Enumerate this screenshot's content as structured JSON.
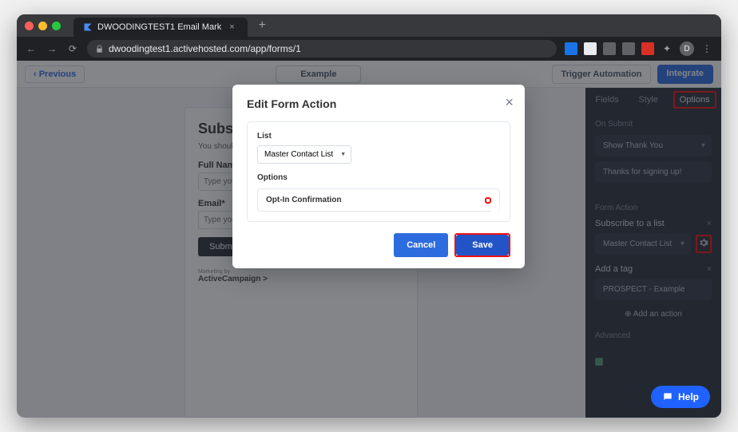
{
  "browser": {
    "tab_title": "DWOODINGTEST1 Email Mark",
    "url": "dwoodingtest1.activehosted.com/app/forms/1",
    "avatar_initial": "D"
  },
  "topbar": {
    "previous": "‹  Previous",
    "form_name": "Example",
    "trigger": "Trigger Automation",
    "integrate": "Integrate"
  },
  "form": {
    "title": "Subscr",
    "subtitle": "You should",
    "fullname_label": "Full Name",
    "fullname_placeholder": "Type your",
    "email_label": "Email*",
    "email_placeholder": "Type your",
    "submit": "Submit",
    "brand_small": "Marketing by",
    "brand": "ActiveCampaign >"
  },
  "sidebar": {
    "tabs": {
      "fields": "Fields",
      "style": "Style",
      "options": "Options"
    },
    "on_submit": {
      "label": "On Submit",
      "action": "Show Thank You",
      "message": "Thanks for signing up!"
    },
    "form_action": {
      "label": "Form Action",
      "subscribe_label": "Subscribe to a list",
      "list_name": "Master Contact List",
      "add_tag_label": "Add a tag",
      "tag_value": "PROSPECT - Example",
      "add_action": "⊕  Add an action",
      "advanced_label": "Advanced"
    }
  },
  "modal": {
    "title": "Edit Form Action",
    "list_label": "List",
    "list_value": "Master Contact List",
    "options_label": "Options",
    "option_name": "Opt-In Confirmation",
    "toggle_state": "OFF",
    "cancel": "Cancel",
    "save": "Save"
  },
  "help": "Help"
}
